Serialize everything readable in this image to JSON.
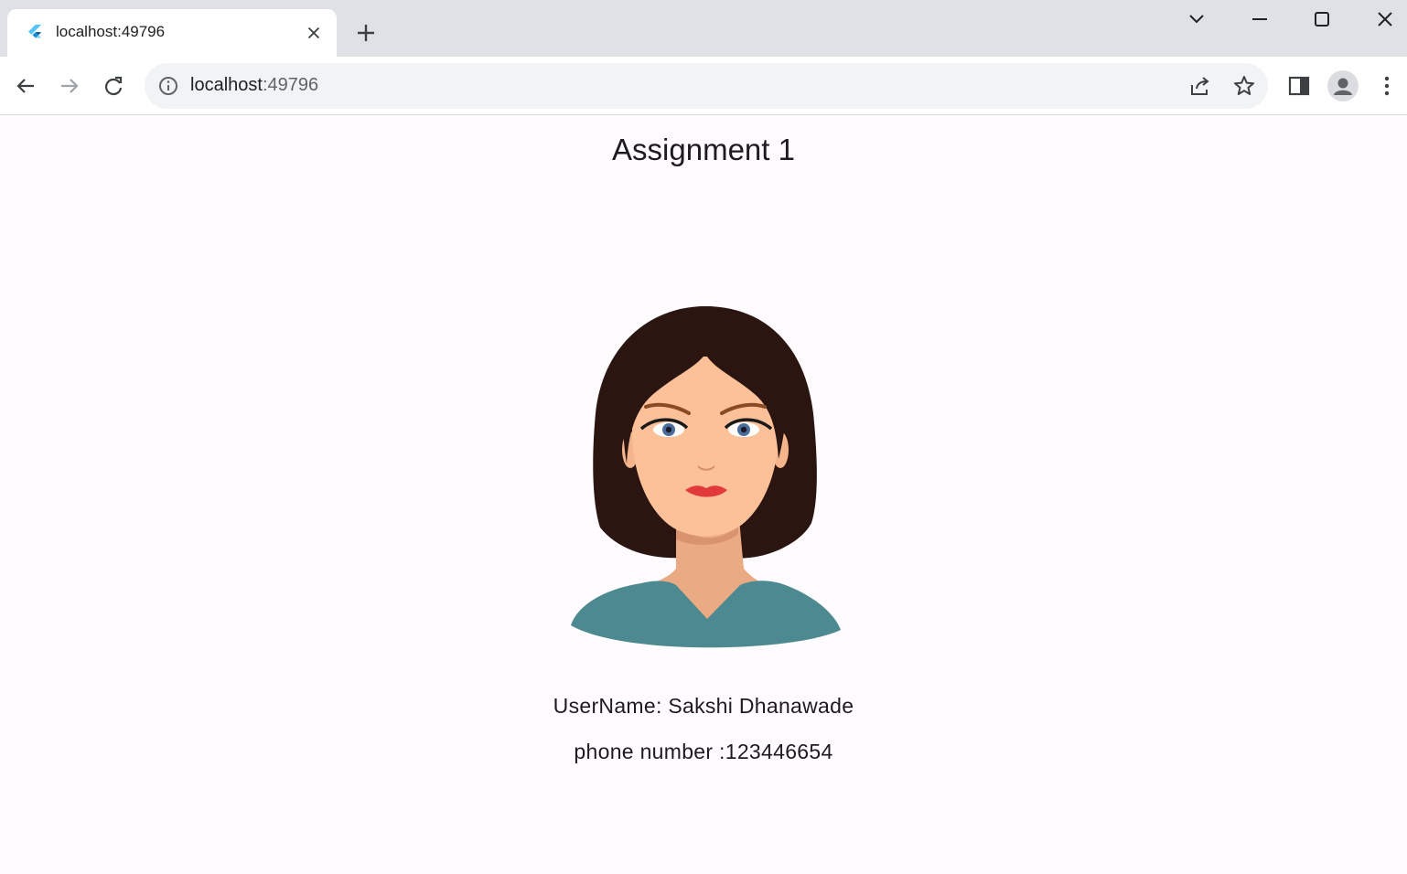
{
  "browser": {
    "tab": {
      "title": "localhost:49796",
      "favicon": "flutter-logo-icon"
    },
    "new_tab_label": "+",
    "window_controls": [
      "tab-search-icon",
      "minimize-icon",
      "maximize-icon",
      "close-icon"
    ],
    "address_bar": {
      "host": "localhost",
      "port": ":49796",
      "site_info_icon": "info-icon"
    },
    "toolbar_icons": [
      "back-arrow-icon",
      "forward-arrow-icon",
      "reload-icon",
      "share-icon",
      "star-icon",
      "side-panel-icon",
      "profile-icon",
      "more-vertical-icon"
    ]
  },
  "page": {
    "title": "Assignment 1",
    "avatar_image": "woman-avatar-illustration",
    "username_line": "UserName: Sakshi Dhanawade",
    "phone_line": "phone number :123446654"
  },
  "colors": {
    "tabstrip": "#dee1e6",
    "page_background": "#fffbfe",
    "text": "#1c1b1f",
    "hair": "#2a1510",
    "skin": "#fdc19a",
    "shirt": "#4d8990",
    "lips": "#e23a3a"
  }
}
